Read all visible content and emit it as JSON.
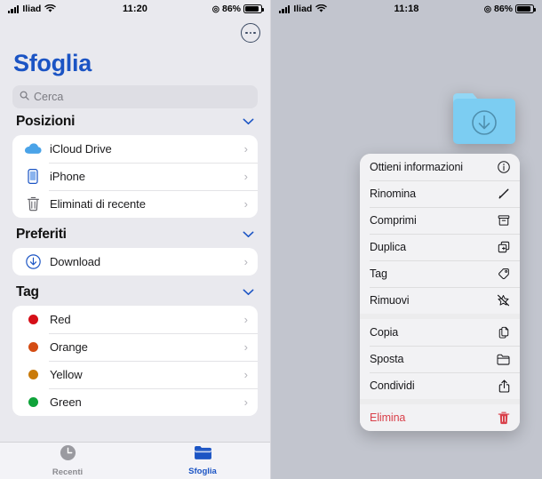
{
  "left": {
    "status": {
      "carrier": "Iliad",
      "time": "11:20",
      "battery": "86%",
      "battery_level": 86,
      "wifi_icon": "wifi-icon",
      "signal_icon": "signal-bars-icon",
      "lock_icon": "rotation-lock-icon"
    },
    "more_button": "more-ellipsis-button",
    "title": "Sfoglia",
    "search": {
      "placeholder": "Cerca",
      "icon": "search-icon"
    },
    "sections": [
      {
        "title": "Posizioni",
        "collapse_icon": "chevron-down-icon",
        "items": [
          {
            "label": "iCloud Drive",
            "icon": "icloud-icon",
            "color": "#4aa3e8",
            "arrow": "chevron-right-icon"
          },
          {
            "label": "iPhone",
            "icon": "iphone-icon",
            "color": "#1b54c4",
            "arrow": "chevron-right-icon"
          },
          {
            "label": "Eliminati di recente",
            "icon": "trash-icon",
            "color": "#5a5a60",
            "arrow": "chevron-right-icon"
          }
        ]
      },
      {
        "title": "Preferiti",
        "collapse_icon": "chevron-down-icon",
        "items": [
          {
            "label": "Download",
            "icon": "download-circle-icon",
            "color": "#1b54c4",
            "arrow": "chevron-right-icon"
          }
        ]
      },
      {
        "title": "Tag",
        "collapse_icon": "chevron-down-icon",
        "items": [
          {
            "label": "Red",
            "icon": "tag-dot-icon",
            "color": "#d50f18",
            "arrow": "chevron-right-icon"
          },
          {
            "label": "Orange",
            "icon": "tag-dot-icon",
            "color": "#d44c13",
            "arrow": "chevron-right-icon"
          },
          {
            "label": "Yellow",
            "icon": "tag-dot-icon",
            "color": "#c97a0a",
            "arrow": "chevron-right-icon"
          },
          {
            "label": "Green",
            "icon": "tag-dot-icon",
            "color": "#0fa33a",
            "arrow": "chevron-right-icon"
          }
        ]
      }
    ],
    "tabs": [
      {
        "label": "Recenti",
        "icon": "clock-icon",
        "active": false
      },
      {
        "label": "Sfoglia",
        "icon": "folder-icon",
        "active": true
      }
    ]
  },
  "right": {
    "status": {
      "carrier": "Iliad",
      "time": "11:18",
      "battery": "86%",
      "battery_level": 86,
      "wifi_icon": "wifi-icon",
      "signal_icon": "signal-bars-icon",
      "lock_icon": "rotation-lock-icon"
    },
    "preview": {
      "name": "download-folder-preview",
      "icon": "folder-download-icon",
      "color": "#7ccdf2"
    },
    "menu_groups": [
      {
        "items": [
          {
            "label": "Ottieni informazioni",
            "icon": "info-circle-icon"
          },
          {
            "label": "Rinomina",
            "icon": "pencil-icon"
          },
          {
            "label": "Comprimi",
            "icon": "archivebox-icon"
          },
          {
            "label": "Duplica",
            "icon": "duplicate-icon"
          },
          {
            "label": "Tag",
            "icon": "tag-icon"
          },
          {
            "label": "Rimuovi",
            "icon": "star-slash-icon"
          }
        ]
      },
      {
        "items": [
          {
            "label": "Copia",
            "icon": "copy-docs-icon"
          },
          {
            "label": "Sposta",
            "icon": "folder-move-icon"
          },
          {
            "label": "Condividi",
            "icon": "share-icon"
          }
        ]
      },
      {
        "items": [
          {
            "label": "Elimina",
            "icon": "trash-icon",
            "destructive": true
          }
        ]
      }
    ]
  },
  "colors": {
    "accent": "#1b54c4",
    "destructive": "#d9404a",
    "left_bg": "#e9e9ee",
    "right_bg": "#c2c5ce",
    "card_bg": "#ffffff",
    "menu_bg": "#f2f2f4"
  }
}
